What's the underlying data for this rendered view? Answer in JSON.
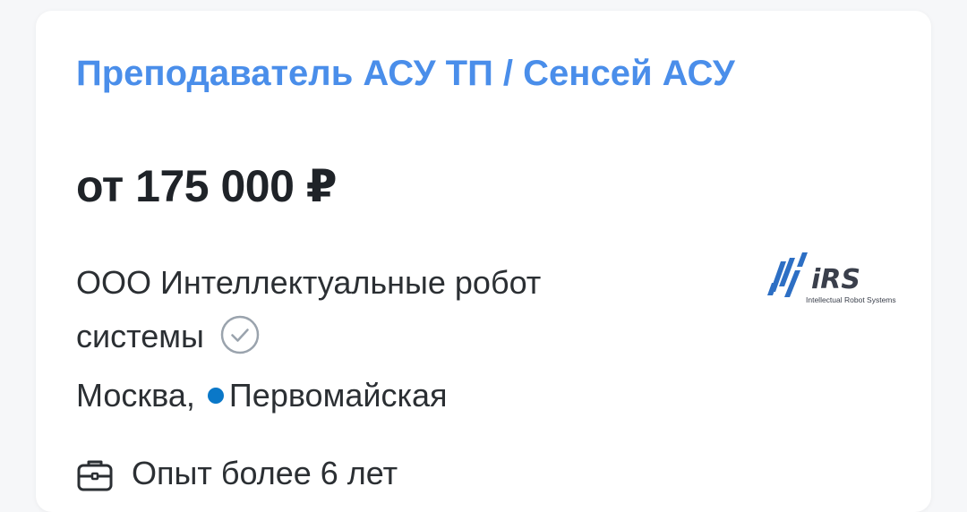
{
  "vacancy": {
    "title": "Преподаватель АСУ ТП / Сенсей АСУ",
    "salary": "от 175 000 ₽",
    "company": "ООО Интеллектуальные робот системы",
    "company_logo_text": "iRS",
    "company_logo_subtitle": "Intellectual Robot Systems",
    "city": "Москва,",
    "metro": "Первомайская",
    "experience": "Опыт более 6 лет"
  },
  "icons": {
    "verified": "check-circle-icon",
    "metro": "metro-dot-icon",
    "experience": "briefcase-icon"
  },
  "colors": {
    "title": "#4a8eea",
    "metro_line": "#0a78c8",
    "logo_blue": "#2d6fc4",
    "logo_dark": "#3a3f4b"
  }
}
